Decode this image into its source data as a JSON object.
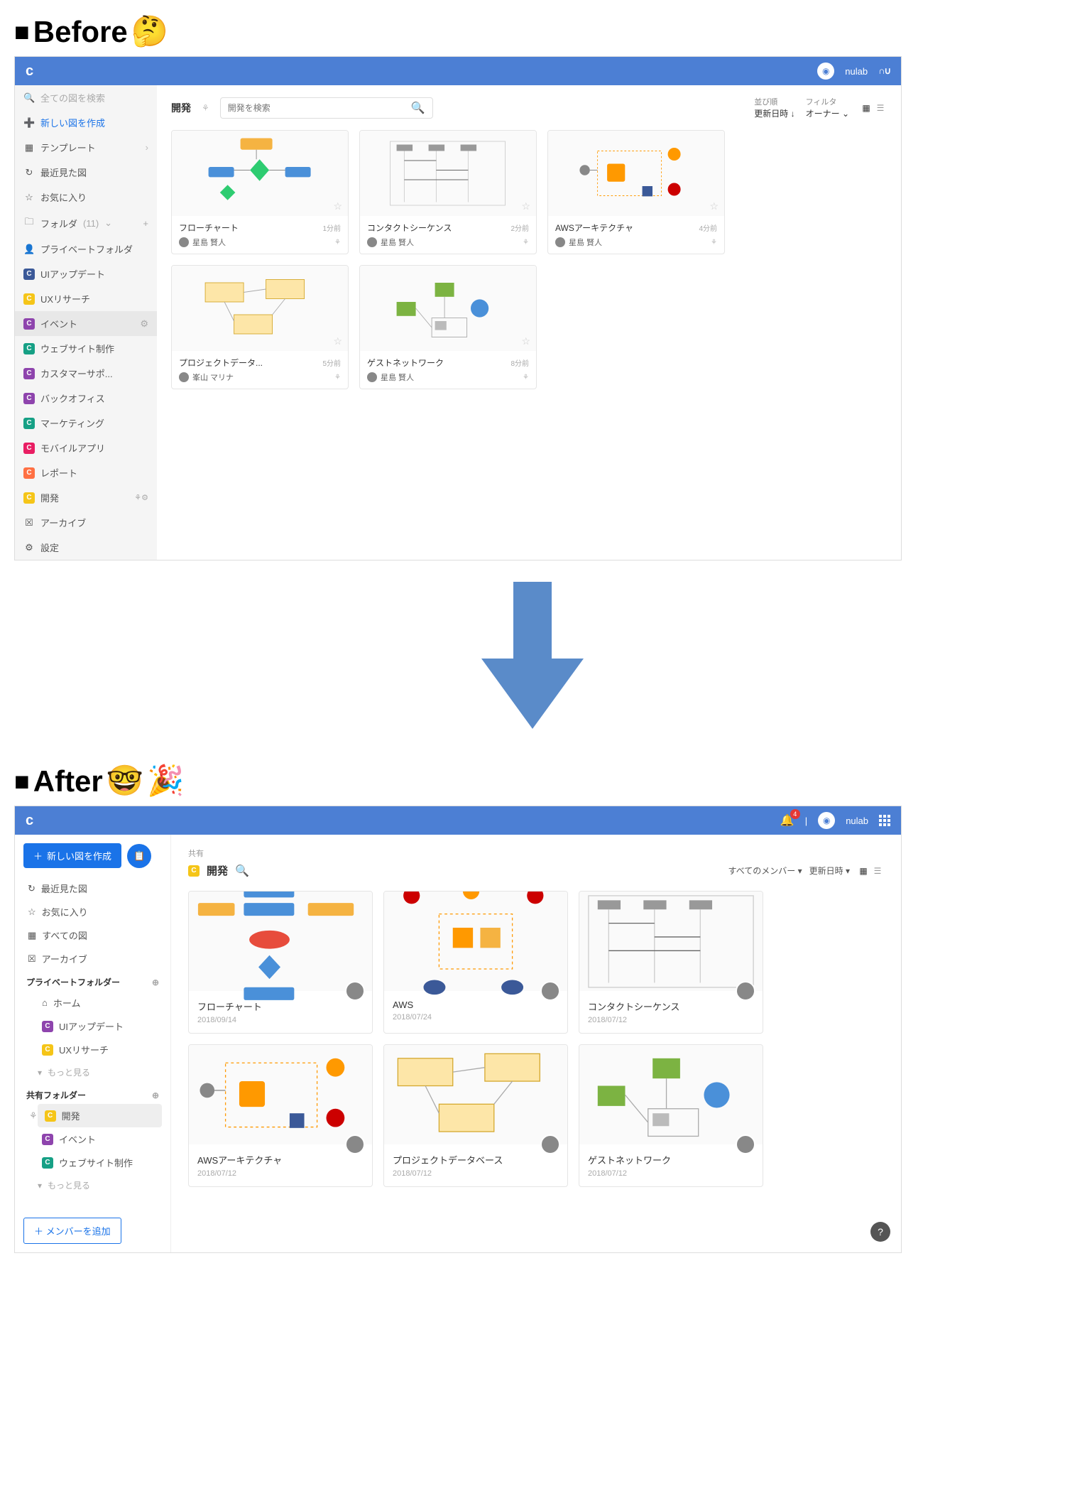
{
  "labels": {
    "before": "Before",
    "after": "After",
    "before_emoji": "🤔",
    "after_emoji1": "🤓",
    "after_emoji2": "🎉"
  },
  "before": {
    "topbar": {
      "user": "nulab",
      "brand": "∩∪",
      "logo_letter": "c"
    },
    "sidebar": {
      "search_placeholder": "全ての図を検索",
      "new": "新しい図を作成",
      "templates": "テンプレート",
      "recent": "最近見た図",
      "favorites": "お気に入り",
      "folder_label": "フォルダ",
      "folder_count": "(11)",
      "private_folder": "プライベートフォルダ",
      "items": [
        {
          "label": "UIアップデート",
          "color": "blue"
        },
        {
          "label": "UXリサーチ",
          "color": "yellow"
        },
        {
          "label": "イベント",
          "color": "purple",
          "selected": true
        },
        {
          "label": "ウェブサイト制作",
          "color": "teal"
        },
        {
          "label": "カスタマーサポ...",
          "color": "purple"
        },
        {
          "label": "バックオフィス",
          "color": "purple"
        },
        {
          "label": "マーケティング",
          "color": "teal"
        },
        {
          "label": "モバイルアプリ",
          "color": "pink"
        },
        {
          "label": "レポート",
          "color": "orange"
        },
        {
          "label": "開発",
          "color": "yellow",
          "current": true
        }
      ],
      "archive": "アーカイブ",
      "settings": "設定"
    },
    "main": {
      "title": "開発",
      "search_placeholder": "開発を検索",
      "sort_label": "並び順",
      "sort_value": "更新日時",
      "filter_label": "フィルタ",
      "filter_value": "オーナー",
      "cards": [
        {
          "title": "フローチャート",
          "time": "1分前",
          "author": "星島 賢人",
          "thumb": "flowchart"
        },
        {
          "title": "コンタクトシーケンス",
          "time": "2分前",
          "author": "星島 賢人",
          "thumb": "seq"
        },
        {
          "title": "AWSアーキテクチャ",
          "time": "4分前",
          "author": "星島 賢人",
          "thumb": "aws"
        },
        {
          "title": "プロジェクトデータ...",
          "time": "5分前",
          "author": "峯山 マリナ",
          "thumb": "db"
        },
        {
          "title": "ゲストネットワーク",
          "time": "8分前",
          "author": "星島 賢人",
          "thumb": "net"
        }
      ]
    }
  },
  "after": {
    "topbar": {
      "user": "nulab",
      "notif_count": "4",
      "logo_letter": "c"
    },
    "sidebar": {
      "new": "新しい図を作成",
      "recent": "最近見た図",
      "favorites": "お気に入り",
      "all": "すべての図",
      "archive": "アーカイブ",
      "private_label": "プライベートフォルダー",
      "private_items": [
        {
          "label": "ホーム",
          "icon": "home"
        },
        {
          "label": "UIアップデート",
          "color": "purple"
        },
        {
          "label": "UXリサーチ",
          "color": "yellow"
        }
      ],
      "more": "もっと見る",
      "shared_label": "共有フォルダー",
      "shared_items": [
        {
          "label": "開発",
          "color": "yellow",
          "selected": true
        },
        {
          "label": "イベント",
          "color": "purple"
        },
        {
          "label": "ウェブサイト制作",
          "color": "teal"
        }
      ],
      "add_member": "メンバーを追加"
    },
    "main": {
      "breadcrumb": "共有",
      "title": "開発",
      "filter_members": "すべてのメンバー",
      "sort": "更新日時",
      "cards": [
        {
          "title": "フローチャート",
          "date": "2018/09/14",
          "thumb": "flowchart2"
        },
        {
          "title": "AWS",
          "date": "2018/07/24",
          "thumb": "aws2"
        },
        {
          "title": "コンタクトシーケンス",
          "date": "2018/07/12",
          "thumb": "seq"
        },
        {
          "title": "AWSアーキテクチャ",
          "date": "2018/07/12",
          "thumb": "aws"
        },
        {
          "title": "プロジェクトデータベース",
          "date": "2018/07/12",
          "thumb": "db"
        },
        {
          "title": "ゲストネットワーク",
          "date": "2018/07/12",
          "thumb": "net"
        }
      ]
    }
  }
}
